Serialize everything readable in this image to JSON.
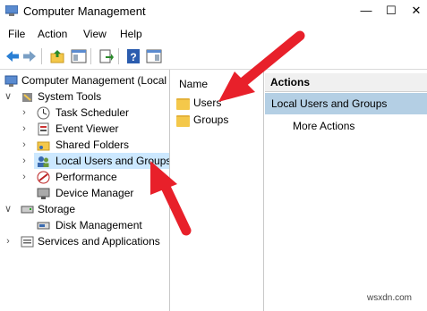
{
  "window": {
    "title": "Computer Management"
  },
  "menu": {
    "items": [
      "File",
      "Action",
      "View",
      "Help"
    ]
  },
  "tree": {
    "root": "Computer Management (Local",
    "system_tools": "System Tools",
    "task_scheduler": "Task Scheduler",
    "event_viewer": "Event Viewer",
    "shared_folders": "Shared Folders",
    "local_users_groups": "Local Users and Groups",
    "performance": "Performance",
    "device_manager": "Device Manager",
    "storage": "Storage",
    "disk_management": "Disk Management",
    "services_apps": "Services and Applications"
  },
  "list": {
    "header": "Name",
    "items": [
      "Users",
      "Groups"
    ]
  },
  "actions": {
    "header": "Actions",
    "section": "Local Users and Groups",
    "more": "More Actions"
  },
  "watermark": "wsxdn.com",
  "colors": {
    "selection": "#cce8ff",
    "actions_selected": "#b4cfe4",
    "annotation_arrow": "#e8202a"
  }
}
